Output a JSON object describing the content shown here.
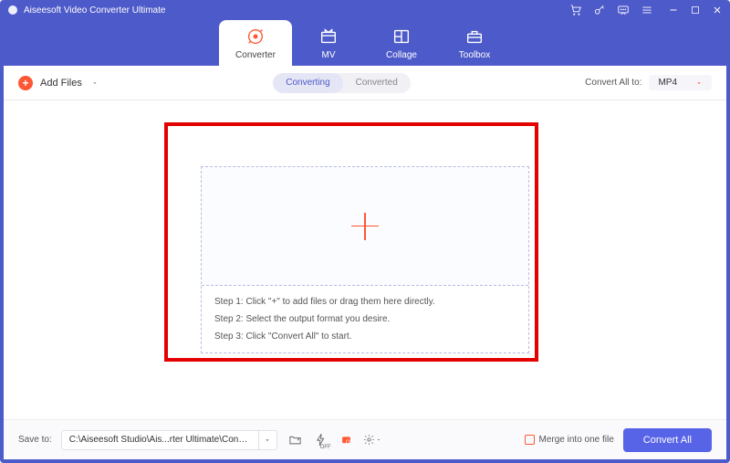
{
  "app": {
    "title": "Aiseesoft Video Converter Ultimate"
  },
  "tabs": {
    "converter": "Converter",
    "mv": "MV",
    "collage": "Collage",
    "toolbox": "Toolbox"
  },
  "toolbar": {
    "add_files": "Add Files",
    "converting": "Converting",
    "converted": "Converted",
    "convert_all_to": "Convert All to:",
    "format": "MP4"
  },
  "dropzone": {
    "step1": "Step 1: Click \"+\" to add files or drag them here directly.",
    "step2": "Step 2: Select the output format you desire.",
    "step3": "Step 3: Click \"Convert All\" to start."
  },
  "footer": {
    "save_to": "Save to:",
    "path": "C:\\Aiseesoft Studio\\Ais...rter Ultimate\\Converted",
    "merge": "Merge into one file",
    "convert_all": "Convert All"
  }
}
